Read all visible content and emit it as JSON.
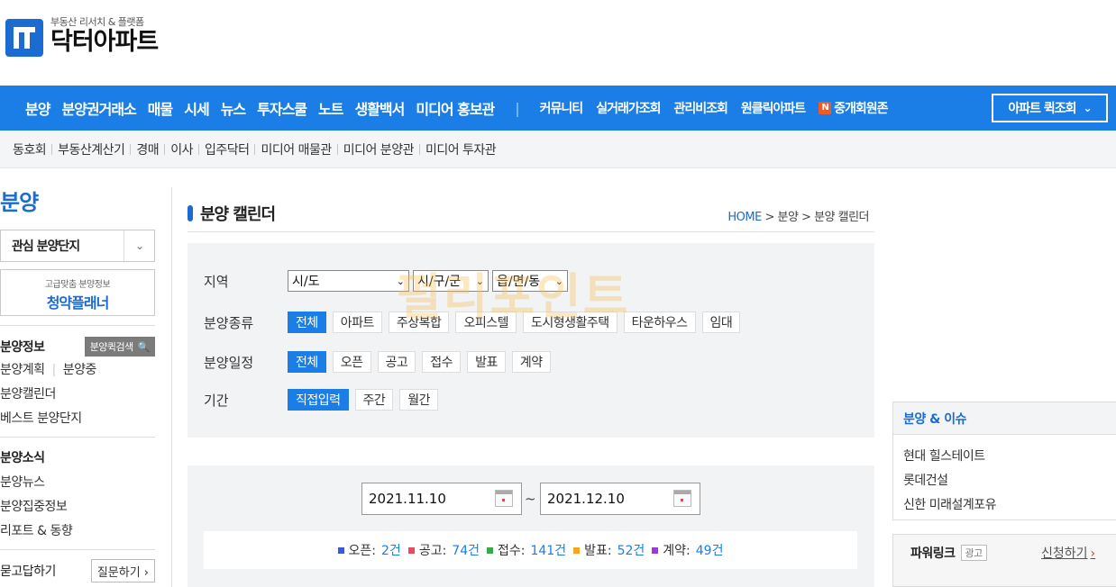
{
  "logo": {
    "subtitle": "부동산 리서치 & 플랫폼",
    "name": "닥터아파트"
  },
  "gnb": {
    "left": [
      "분양",
      "분양권거래소",
      "매물",
      "시세",
      "뉴스",
      "투자스쿨",
      "노트",
      "생활백서",
      "미디어 홍보관"
    ],
    "separator": "|",
    "right": [
      "커뮤니티",
      "실거래가조회",
      "관리비조회",
      "원클릭아파트",
      "중개회원존"
    ],
    "n_badge": "N",
    "quiz": "아파트 퀵조회",
    "quiz_chevron": "⌄"
  },
  "snb": [
    "동호회",
    "부동산계산기",
    "경매",
    "이사",
    "입주닥터",
    "미디어 매물관",
    "미디어 분양관",
    "미디어 투자관"
  ],
  "sidebar": {
    "title": "분양",
    "fav_select": "관심 분양단지",
    "fav_arrow": "⌄",
    "planner_sub": "고급맞춤 분양정보",
    "planner_main": "청약플래너",
    "info_head": "분양정보",
    "quick_search": "분양퀵검색",
    "quick_icon": "🔍",
    "plan_link": "분양계획",
    "pipe": "|",
    "ing_link": "분양중",
    "calendar_link": "분양캘린더",
    "best_link": "베스트 분양단지",
    "news_head": "분양소식",
    "news_link": "분양뉴스",
    "focus_link": "분양집중정보",
    "report_link": "리포트 & 동향",
    "qa_head": "묻고답하기",
    "ask_btn": "질문하기 ›"
  },
  "main": {
    "title": "분양 캘린더",
    "breadcrumb_home": "HOME",
    "breadcrumb_rest": " > 분양 > 분양 캘린더",
    "watermark": "펄리포인트",
    "filters": {
      "region_label": "지역",
      "region_selects": [
        "시/도",
        "시/구/군",
        "읍/면/동"
      ],
      "dd_icon": "⌄",
      "type_label": "분양종류",
      "types": [
        "전체",
        "아파트",
        "주상복합",
        "오피스텔",
        "도시형생활주택",
        "타운하우스",
        "임대"
      ],
      "schedule_label": "분양일정",
      "schedules": [
        "전체",
        "오픈",
        "공고",
        "접수",
        "발표",
        "계약"
      ],
      "period_label": "기간",
      "periods": [
        "직접입력",
        "주간",
        "월간"
      ]
    },
    "date_from": "2021.11.10",
    "date_to": "2021.12.10",
    "tilde": "~",
    "stats": [
      {
        "label": "오픈:",
        "count": "2건",
        "color": "#3a5bd9"
      },
      {
        "label": "공고:",
        "count": "74건",
        "color": "#e84a5f"
      },
      {
        "label": "접수:",
        "count": "141건",
        "color": "#3aa84a"
      },
      {
        "label": "발표:",
        "count": "52건",
        "color": "#f5a623"
      },
      {
        "label": "계약:",
        "count": "49건",
        "color": "#9b3ad9"
      }
    ]
  },
  "right": {
    "issue_head": "분양 & 이슈",
    "issues": [
      "현대 힐스테이트",
      "롯데건설",
      "신한 미래설계포유"
    ],
    "power_title": "파워링크",
    "ad_tag": "광고",
    "apply": "신청하기",
    "apply_arrow": "›"
  }
}
